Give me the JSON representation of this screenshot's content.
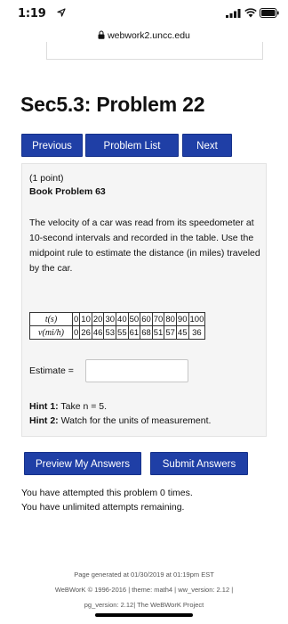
{
  "status_bar": {
    "time": "1:19",
    "icons": [
      "location-arrow-icon",
      "signal-bars-icon",
      "wifi-icon",
      "battery-icon"
    ]
  },
  "browser": {
    "url": "webwork2.uncc.edu",
    "secure_icon": "lock-icon"
  },
  "page": {
    "title": "Sec5.3: Problem 22"
  },
  "nav": {
    "previous": "Previous",
    "problem_list": "Problem List",
    "next": "Next"
  },
  "problem": {
    "points": "(1 point)",
    "book": "Book Problem 63",
    "statement": "The velocity of a car was read from its speedometer at 10-second intervals and recorded in the table. Use the midpoint rule to estimate the distance (in miles) traveled by the car.",
    "table": {
      "row_labels": [
        "t(s)",
        "v(mi/h)"
      ],
      "t_values": [
        "0",
        "10",
        "20",
        "30",
        "40",
        "50",
        "60",
        "70",
        "80",
        "90",
        "100"
      ],
      "v_values": [
        "0",
        "26",
        "46",
        "53",
        "55",
        "61",
        "68",
        "51",
        "57",
        "45",
        "36"
      ]
    },
    "estimate_label": "Estimate =",
    "estimate_value": "",
    "hint1_label": "Hint 1:",
    "hint1_text": "Take n = 5.",
    "hint2_label": "Hint 2:",
    "hint2_text": "Watch for the units of measurement."
  },
  "actions": {
    "preview": "Preview My Answers",
    "submit": "Submit Answers"
  },
  "attempts": {
    "line1": "You have attempted this problem 0 times.",
    "line2": "You have unlimited attempts remaining."
  },
  "footer": {
    "line1": "Page generated at 01/30/2019 at 01:19pm EST",
    "line2": "WeBWorK © 1996-2016 | theme: math4 | ww_version: 2.12 |",
    "line3": "pg_version: 2.12| The WeBWorK Project"
  },
  "colors": {
    "button_blue": "#1f3fa6",
    "panel_bg": "#f5f5f5"
  }
}
